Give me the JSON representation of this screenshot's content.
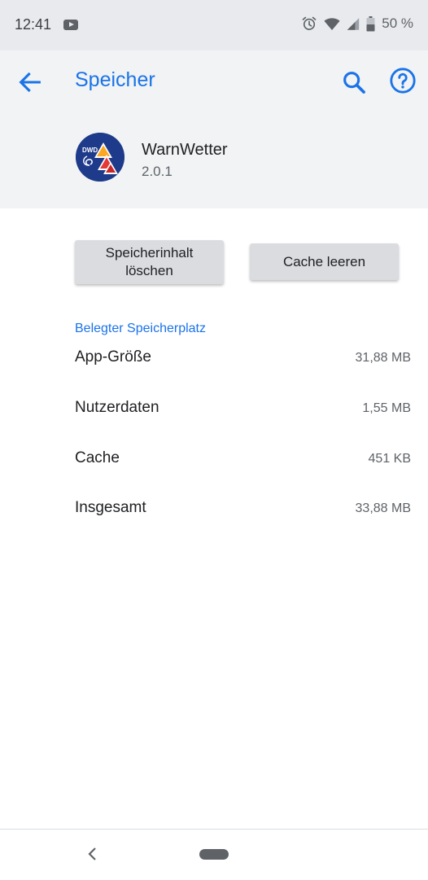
{
  "status_bar": {
    "time": "12:41",
    "battery": "50 %"
  },
  "app_bar": {
    "title": "Speicher"
  },
  "app_info": {
    "name": "WarnWetter",
    "version": "2.0.1",
    "icon_text": "DWD"
  },
  "actions": {
    "clear_storage_line1": "Speicherinhalt",
    "clear_storage_line2": "löschen",
    "clear_cache": "Cache leeren"
  },
  "storage": {
    "header": "Belegter Speicherplatz",
    "rows": [
      {
        "label": "App-Größe",
        "value": "31,88 MB"
      },
      {
        "label": "Nutzerdaten",
        "value": "1,55 MB"
      },
      {
        "label": "Cache",
        "value": "451 KB"
      },
      {
        "label": "Insgesamt",
        "value": "33,88 MB"
      }
    ]
  },
  "colors": {
    "accent": "#1a73e8",
    "app_bar_bg": "#f1f3f4",
    "status_bar_bg": "#e8eaed",
    "button_bg": "#dadce0"
  }
}
